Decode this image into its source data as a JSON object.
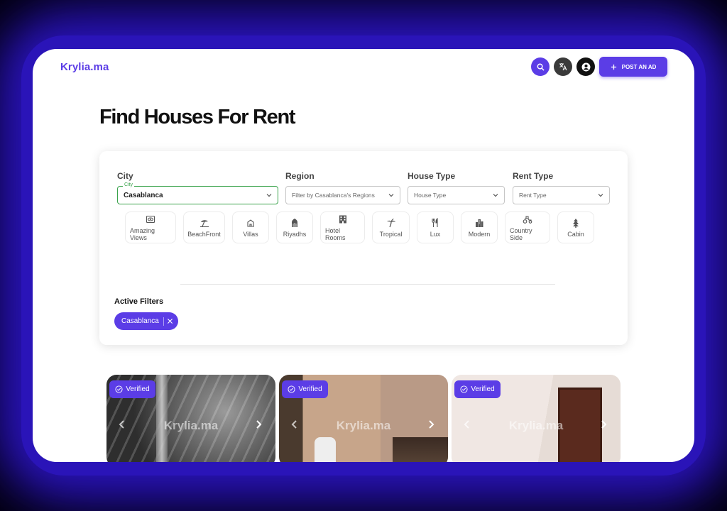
{
  "app": {
    "logo": "Krylia.ma"
  },
  "header": {
    "post_ad_label": "POST AN AD"
  },
  "page": {
    "title": "Find Houses For Rent"
  },
  "filters": {
    "city": {
      "label": "City",
      "floating_label": "City",
      "value": "Casablanca"
    },
    "region": {
      "label": "Region",
      "placeholder": "Filter by Casablanca's Regions"
    },
    "house_type": {
      "label": "House Type",
      "placeholder": "House Type"
    },
    "rent_type": {
      "label": "Rent Type",
      "placeholder": "Rent Type"
    }
  },
  "categories": [
    {
      "label": "Amazing Views",
      "icon": "eye-icon"
    },
    {
      "label": "BeachFront",
      "icon": "beach-umbrella-icon"
    },
    {
      "label": "Villas",
      "icon": "villa-icon"
    },
    {
      "label": "Riyadhs",
      "icon": "riyadh-icon"
    },
    {
      "label": "Hotel Rooms",
      "icon": "hotel-icon"
    },
    {
      "label": "Tropical",
      "icon": "palm-tree-icon"
    },
    {
      "label": "Lux",
      "icon": "utensils-icon"
    },
    {
      "label": "Modern",
      "icon": "modern-building-icon"
    },
    {
      "label": "Country Side",
      "icon": "tractor-icon"
    },
    {
      "label": "Cabin",
      "icon": "pine-tree-icon"
    }
  ],
  "active_filters": {
    "title": "Active Filters",
    "chips": [
      "Casablanca"
    ]
  },
  "listings": [
    {
      "badge": "Verified",
      "watermark": "Krylia.ma"
    },
    {
      "badge": "Verified",
      "watermark": "Krylia.ma"
    },
    {
      "badge": "Verified",
      "watermark": "Krylia.ma"
    }
  ],
  "colors": {
    "accent": "#5b3de6",
    "success": "#3aa34c",
    "glow": "#2a14b8"
  }
}
